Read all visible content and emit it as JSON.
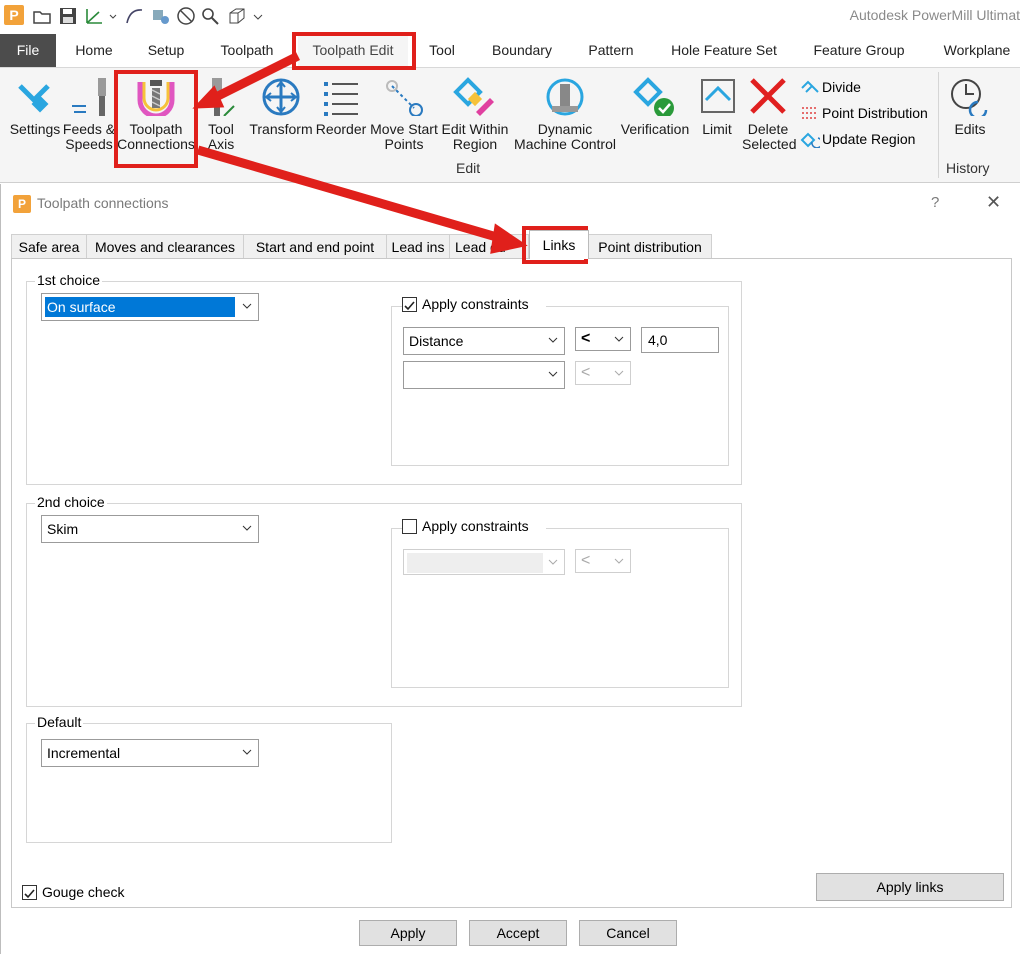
{
  "app": {
    "logo_letter": "P",
    "title": "Autodesk PowerMill Ultimat"
  },
  "ribbon_tabs": {
    "file": "File",
    "home": "Home",
    "setup": "Setup",
    "toolpath": "Toolpath",
    "toolpath_edit": "Toolpath Edit",
    "tool": "Tool",
    "boundary": "Boundary",
    "pattern": "Pattern",
    "hole_feature_set": "Hole Feature Set",
    "feature_group": "Feature Group",
    "workplane": "Workplane"
  },
  "ribbon": {
    "settings": "Settings",
    "feeds_1": "Feeds &",
    "feeds_2": "Speeds",
    "tc_1": "Toolpath",
    "tc_2": "Connections",
    "ta_1": "Tool",
    "ta_2": "Axis",
    "transform": "Transform",
    "reorder": "Reorder",
    "ms_1": "Move Start",
    "ms_2": "Points",
    "ew_1": "Edit Within",
    "ew_2": "Region",
    "dm_1": "Dynamic",
    "dm_2": "Machine Control",
    "verification": "Verification",
    "limit": "Limit",
    "ds_1": "Delete",
    "ds_2": "Selected",
    "divide": "Divide",
    "point_distribution": "Point Distribution",
    "update_region": "Update Region",
    "edits": "Edits",
    "group_edit": "Edit",
    "group_history": "History"
  },
  "dialog": {
    "title": "Toolpath connections",
    "help": "?",
    "close": "✕",
    "tabs": {
      "safe_area": "Safe area",
      "moves_clearances": "Moves and clearances",
      "start_end": "Start and end point",
      "lead_ins": "Lead ins",
      "lead_outs": "Lead ou",
      "links": "Links",
      "point_distribution": "Point distribution"
    },
    "first": {
      "legend": "1st choice",
      "value": "On surface",
      "apply_constraints": "Apply constraints",
      "apply_checked": true,
      "constraint1": "Distance",
      "op1": "<",
      "value1": "4,0",
      "constraint2": "",
      "op2": "<"
    },
    "second": {
      "legend": "2nd choice",
      "value": "Skim",
      "apply_constraints": "Apply constraints",
      "apply_checked": false,
      "op": "<"
    },
    "default": {
      "legend": "Default",
      "value": "Incremental"
    },
    "gouge_check": "Gouge check",
    "gouge_checked": true,
    "apply_links": "Apply links",
    "buttons": {
      "apply": "Apply",
      "accept": "Accept",
      "cancel": "Cancel"
    }
  },
  "colors": {
    "annotation_red": "#e0201b",
    "selection_blue": "#0078d7",
    "file_tab_bg": "#4c4c4c"
  }
}
